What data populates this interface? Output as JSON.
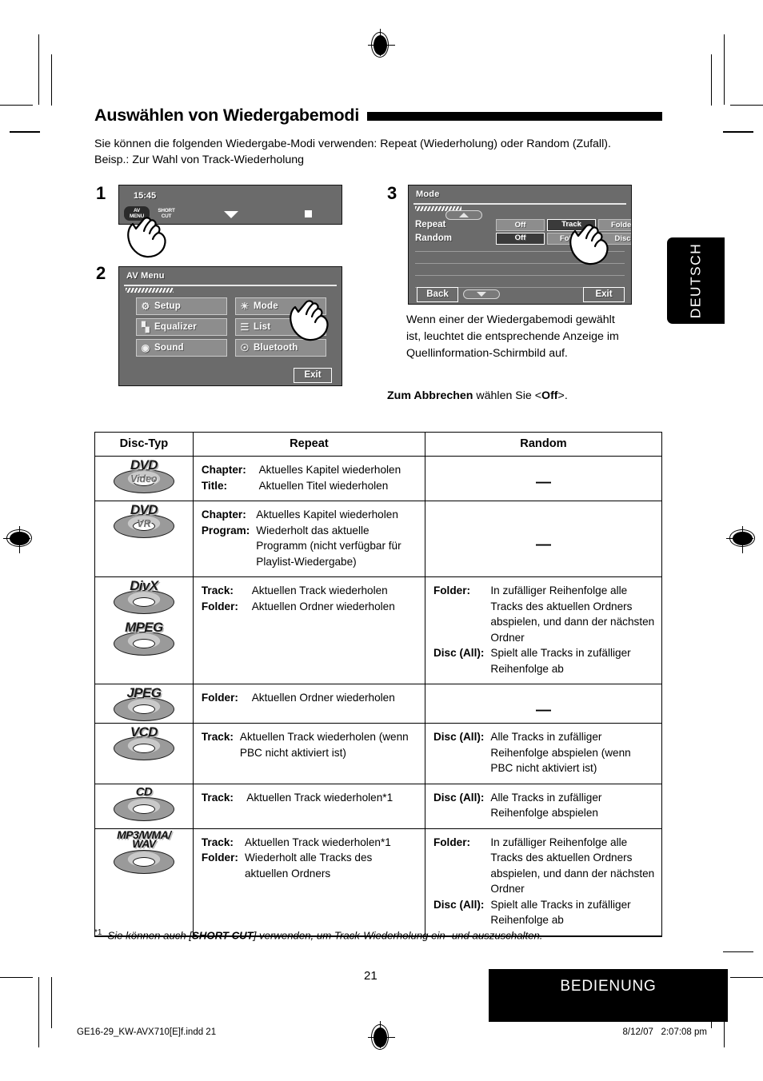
{
  "header": {
    "title": "Auswählen von Wiedergabemodi",
    "intro_line1": "Sie können die folgenden Wiedergabe-Modi verwenden: Repeat (Wiederholung) oder Random (Zufall).",
    "intro_line2": "Beisp.: Zur Wahl von Track-Wiederholung"
  },
  "side_tab": {
    "label": "DEUTSCH"
  },
  "steps": {
    "step1": {
      "number": "1",
      "screen": {
        "clock": "15:45",
        "av_menu_line1": "AV",
        "av_menu_line2": "MENU",
        "short_cut_line1": "SHORT",
        "short_cut_line2": "CUT",
        "down_arrow_icon": "triangle-down-icon",
        "stop_icon": "stop-square-icon"
      }
    },
    "step2": {
      "number": "2",
      "screen": {
        "title": "AV Menu",
        "buttons": [
          {
            "icon": "gear-icon",
            "label": "Setup"
          },
          {
            "icon": "mode-sun-icon",
            "label": "Mode"
          },
          {
            "icon": "equalizer-icon",
            "label": "Equalizer"
          },
          {
            "icon": "list-icon",
            "label": "List"
          },
          {
            "icon": "speaker-icon",
            "label": "Sound"
          },
          {
            "icon": "bluetooth-icon",
            "label": "Bluetooth"
          }
        ],
        "exit_label": "Exit"
      }
    },
    "step3": {
      "number": "3",
      "screen": {
        "title": "Mode",
        "rows": [
          {
            "label": "Repeat",
            "options": [
              "Off",
              "Track",
              "Folder"
            ],
            "selected": "Track"
          },
          {
            "label": "Random",
            "options": [
              "Off",
              "Folder",
              "Disc"
            ],
            "selected": "Off"
          }
        ],
        "back_label": "Back",
        "exit_label": "Exit",
        "scroll_up_icon": "triangle-up-icon",
        "scroll_down_icon": "triangle-down-icon"
      }
    }
  },
  "note": {
    "line1": "Wenn einer der Wiedergabemodi gewählt",
    "line2": "ist, leuchtet die entsprechende Anzeige im",
    "line3": "Quellinformation-Schirmbild auf."
  },
  "cancel_note": {
    "bold": "Zum Abbrechen",
    "rest": " wählen Sie <",
    "bold2": "Off",
    "tail": ">."
  },
  "table": {
    "headers": [
      "Disc-Typ",
      "Repeat",
      "Random"
    ],
    "rows": [
      {
        "disc": {
          "label": "DVD",
          "sub": "Video",
          "type": "disc"
        },
        "repeat": [
          {
            "term": "Chapter:",
            "desc": "Aktuelles Kapitel wiederholen"
          },
          {
            "term": "Title:",
            "desc": "Aktuellen Titel wiederholen"
          }
        ],
        "random": "—"
      },
      {
        "disc": {
          "label": "DVD",
          "sub": "VR",
          "type": "disc"
        },
        "repeat": [
          {
            "term": "Chapter:",
            "desc": "Aktuelles Kapitel wiederholen"
          },
          {
            "term": "Program:",
            "desc": "Wiederholt das aktuelle Programm (nicht verfügbar für Playlist-Wiedergabe)"
          }
        ],
        "random": "—"
      },
      {
        "disc": {
          "label": "DivX",
          "label2": "MPEG",
          "type": "double-disc"
        },
        "repeat": [
          {
            "term": "Track:",
            "desc": "Aktuellen Track wiederholen"
          },
          {
            "term": "Folder:",
            "desc": "Aktuellen Ordner wiederholen"
          }
        ],
        "random_list": [
          {
            "term": "Folder:",
            "desc": "In zufälliger Reihenfolge alle Tracks des aktuellen Ordners abspielen, und dann der nächsten Ordner"
          },
          {
            "term": "Disc (All):",
            "desc": "Spielt alle Tracks in zufälliger Reihenfolge ab"
          }
        ]
      },
      {
        "disc": {
          "label": "JPEG",
          "type": "disc"
        },
        "repeat": [
          {
            "term": "Folder:",
            "desc": "Aktuellen Ordner wiederholen"
          }
        ],
        "random": "—"
      },
      {
        "disc": {
          "label": "VCD",
          "type": "disc"
        },
        "repeat": [
          {
            "term": "Track:",
            "desc": "Aktuellen Track wiederholen (wenn PBC nicht aktiviert ist)"
          }
        ],
        "random_list": [
          {
            "term": "Disc (All):",
            "desc": "Alle Tracks in zufälliger Reihenfolge abspielen (wenn PBC nicht aktiviert ist)"
          }
        ]
      },
      {
        "disc": {
          "label": "CD",
          "type": "disc"
        },
        "repeat": [
          {
            "term": "Track:",
            "desc": "Aktuellen Track wiederholen*1",
            "sup": "*1"
          }
        ],
        "random_list": [
          {
            "term": "Disc (All):",
            "desc": "Alle Tracks in zufälliger Reihenfolge abspielen"
          }
        ]
      },
      {
        "disc": {
          "label": "MP3/WMA/",
          "label2": "WAV",
          "type": "text-disc"
        },
        "repeat": [
          {
            "term": "Track:",
            "desc": "Aktuellen Track wiederholen*1",
            "sup": "*1"
          },
          {
            "term": "Folder:",
            "desc": "Wiederholt alle Tracks des aktuellen Ordners"
          }
        ],
        "random_list": [
          {
            "term": "Folder:",
            "desc": "In zufälliger Reihenfolge alle Tracks des aktuellen Ordners abspielen, und dann der nächsten Ordner"
          },
          {
            "term": "Disc (All):",
            "desc": "Spielt alle Tracks in zufälliger Reihenfolge ab"
          }
        ]
      }
    ]
  },
  "footnote": {
    "mark": "*1",
    "text_a": "Sie können auch [",
    "text_bold": "SHORT CUT",
    "text_b": "] verwenden, um Track-Wiederholung ein- und auszuschalten."
  },
  "footer": {
    "page_number": "21",
    "section_label": "BEDIENUNG",
    "file_name": "GE16-29_KW-AVX710[E]f.indd   21",
    "timestamp": "8/12/07   2:07:08 pm"
  }
}
